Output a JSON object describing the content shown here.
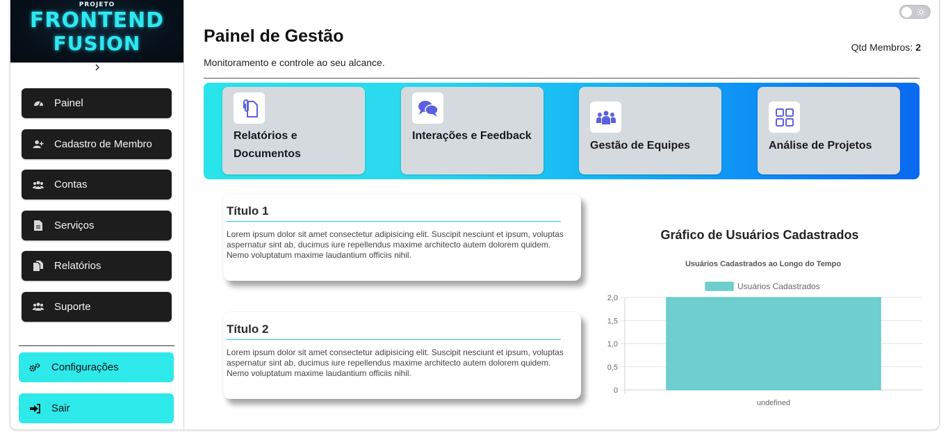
{
  "sidebar": {
    "logo_top": "PROJETO",
    "logo_line1": "FRONTEND",
    "logo_line2": "FUSION",
    "items": [
      {
        "label": "Painel",
        "icon": "gauge-icon"
      },
      {
        "label": "Cadastro de Membro",
        "icon": "user-plus-icon"
      },
      {
        "label": "Contas",
        "icon": "users-icon"
      },
      {
        "label": "Serviços",
        "icon": "file-icon"
      },
      {
        "label": "Relatórios",
        "icon": "copy-file-icon"
      },
      {
        "label": "Suporte",
        "icon": "users-icon"
      }
    ],
    "settings_label": "Configurações",
    "logout_label": "Sair"
  },
  "header": {
    "title": "Painel de Gestão",
    "subtitle": "Monitoramento e controle ao seu alcance.",
    "members_label": "Qtd Membros:",
    "members_count": "2"
  },
  "cards": [
    {
      "label": "Relatórios e Documentos",
      "icon": "paperclip-file-icon"
    },
    {
      "label": "Interações e Feedback",
      "icon": "comments-icon"
    },
    {
      "label": "Gestão de Equipes",
      "icon": "people-group-icon"
    },
    {
      "label": "Análise de Projetos",
      "icon": "grid-icon"
    }
  ],
  "text_cards": [
    {
      "title": "Título 1",
      "body": "Lorem ipsum dolor sit amet consectetur adipisicing elit. Suscipit nesciunt et ipsum, voluptas aspernatur sint ab, ducimus iure repellendus maxime architecto autem dolorem quidem. Nemo voluptatum maxime laudantium officiis nihil."
    },
    {
      "title": "Título 2",
      "body": "Lorem ipsum dolor sit amet consectetur adipisicing elit. Suscipit nesciunt et ipsum, voluptas aspernatur sint ab, ducimus iure repellendus maxime architecto autem dolorem quidem. Nemo voluptatum maxime laudantium officiis nihil."
    }
  ],
  "chart_section_title": "Gráfico de Usuários Cadastrados",
  "colors": {
    "accent": "#2ee9ea",
    "sidebar_button": "#1d1d1d",
    "bar_fill": "#6fcfcf",
    "bar_border": "#4bc0c0"
  },
  "chart_data": {
    "type": "bar",
    "title": "Usuários Cadastrados ao Longo do Tempo",
    "categories": [
      "undefined"
    ],
    "series": [
      {
        "name": "Usuários Cadastrados",
        "values": [
          2
        ]
      }
    ],
    "ylim": [
      0,
      2
    ],
    "yticks": [
      "0",
      "0,5",
      "1,0",
      "1,5",
      "2,0"
    ],
    "legend": "top",
    "grid": true
  }
}
